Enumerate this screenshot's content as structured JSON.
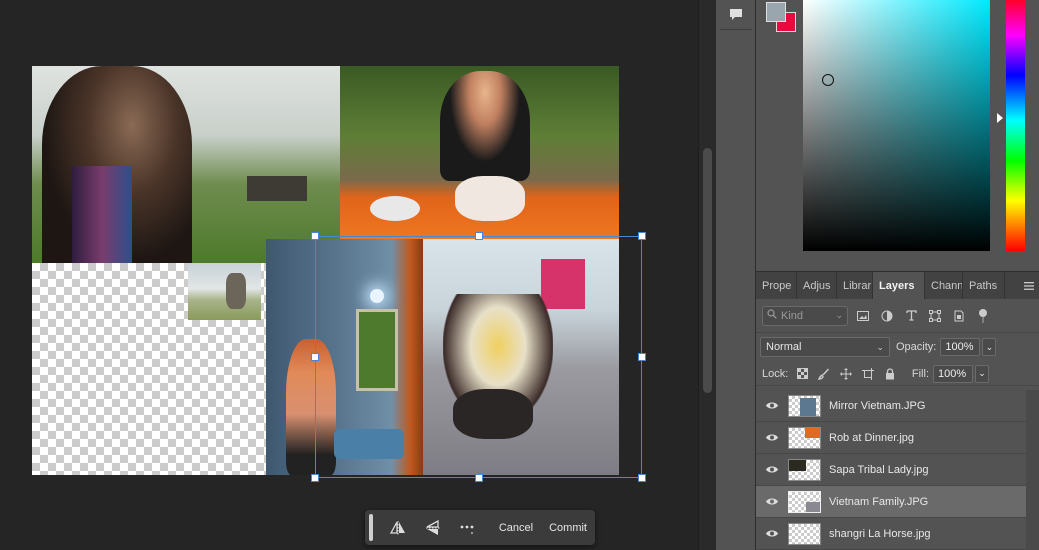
{
  "taskbar": {
    "flip_h_icon": "flip-horizontal-icon",
    "flip_v_icon": "flip-vertical-icon",
    "more_icon": "more-icon",
    "cancel_label": "Cancel",
    "commit_label": "Commit"
  },
  "color": {
    "foreground": "#9aa6ad",
    "background": "#e8093f",
    "hue": "#00e9ff"
  },
  "panel_tabs": [
    {
      "label": "Prope",
      "active": false
    },
    {
      "label": "Adjus",
      "active": false
    },
    {
      "label": "Librar",
      "active": false
    },
    {
      "label": "Layers",
      "active": true
    },
    {
      "label": "Chann",
      "active": false
    },
    {
      "label": "Paths",
      "active": false
    }
  ],
  "layers_panel": {
    "kind_placeholder": "Kind",
    "blend_mode": "Normal",
    "opacity_label": "Opacity:",
    "opacity_value": "100%",
    "lock_label": "Lock:",
    "fill_label": "Fill:",
    "fill_value": "100%",
    "layers": [
      {
        "name": "Mirror Vietnam.JPG",
        "visible": true,
        "selected": false
      },
      {
        "name": "Rob at Dinner.jpg",
        "visible": true,
        "selected": false
      },
      {
        "name": "Sapa Tribal Lady.jpg",
        "visible": true,
        "selected": false
      },
      {
        "name": "Vietnam Family.JPG",
        "visible": true,
        "selected": true
      },
      {
        "name": "shangri La Horse.jpg",
        "visible": true,
        "selected": false
      }
    ]
  }
}
